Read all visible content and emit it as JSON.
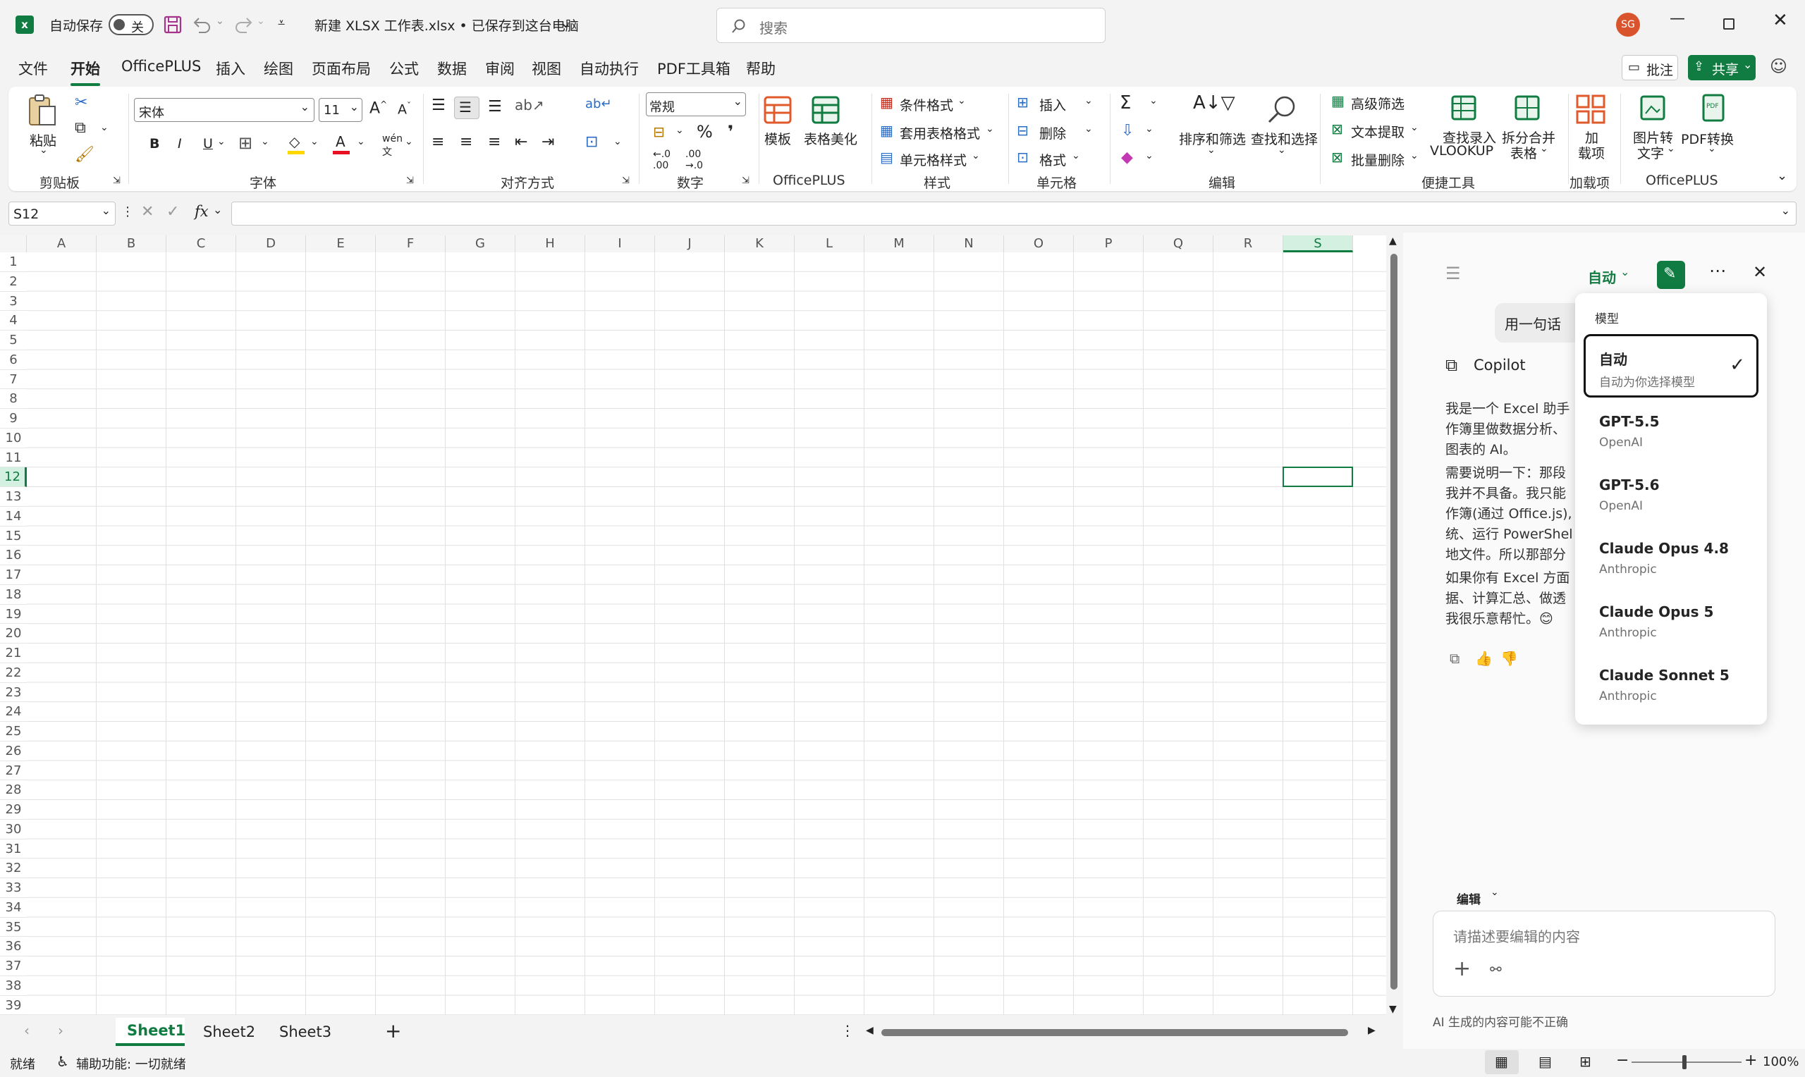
{
  "titlebar": {
    "autosave_label": "自动保存",
    "autosave_state": "关",
    "file_title": "新建 XLSX 工作表.xlsx • 已保存到这台电脑",
    "search_placeholder": "搜索",
    "avatar_initials": "SG"
  },
  "menu": {
    "items": [
      "文件",
      "开始",
      "OfficePLUS",
      "插入",
      "绘图",
      "页面布局",
      "公式",
      "数据",
      "审阅",
      "视图",
      "自动执行",
      "PDF工具箱",
      "帮助"
    ],
    "active": "开始",
    "comment_label": "批注",
    "share_label": "共享"
  },
  "ribbon": {
    "clipboard": {
      "paste": "粘贴",
      "group": "剪贴板"
    },
    "font": {
      "name": "宋体",
      "size": "11",
      "group": "字体",
      "bold": "B",
      "italic": "I",
      "underline": "U"
    },
    "align": {
      "group": "对齐方式"
    },
    "number": {
      "format": "常规",
      "group": "数字"
    },
    "officeplus": {
      "template": "模板",
      "beautify": "表格美化",
      "group": "OfficePLUS"
    },
    "styles": {
      "cond": "条件格式",
      "table": "套用表格格式",
      "cell": "单元格样式",
      "group": "样式"
    },
    "cells": {
      "insert": "插入",
      "delete": "删除",
      "format": "格式",
      "group": "单元格"
    },
    "editing": {
      "sort": "排序和筛选",
      "find": "查找和选择",
      "group": "编辑"
    },
    "tools": {
      "advfilter": "高级筛选",
      "textextract": "文本提取",
      "batchdelete": "批量删除",
      "vlookup1": "查找录入",
      "vlookup2": "VLOOKUP",
      "split1": "拆分合并",
      "split2": "表格",
      "group": "便捷工具"
    },
    "addins": {
      "label1": "加",
      "label2": "载项",
      "group": "加载项"
    },
    "officeplus2": {
      "img1": "图片转",
      "img2": "文字",
      "pdf": "PDF转换",
      "group": "OfficePLUS"
    }
  },
  "formula": {
    "namebox": "S12",
    "fx": "fx"
  },
  "grid": {
    "columns": [
      "A",
      "B",
      "C",
      "D",
      "E",
      "F",
      "G",
      "H",
      "I",
      "J",
      "K",
      "L",
      "M",
      "N",
      "O",
      "P",
      "Q",
      "R",
      "S"
    ],
    "selected_col": "S",
    "selected_row": 12,
    "rows": [
      "1",
      "2",
      "3",
      "4",
      "5",
      "6",
      "7",
      "8",
      "9",
      "10",
      "11",
      "12",
      "13",
      "14",
      "15",
      "16",
      "17",
      "18",
      "19",
      "20",
      "21",
      "22",
      "23",
      "24",
      "25",
      "26",
      "27",
      "28",
      "29",
      "30",
      "31",
      "32",
      "33",
      "34",
      "35",
      "36",
      "37",
      "38",
      "39"
    ]
  },
  "sheets": {
    "tabs": [
      "Sheet1",
      "Sheet2",
      "Sheet3"
    ],
    "active": "Sheet1"
  },
  "status": {
    "ready": "就绪",
    "accessibility": "辅助功能: 一切就绪",
    "zoom": "100%"
  },
  "copilot": {
    "mode_label": "自动",
    "user_msg": "用一句话",
    "assistant_name": "Copilot",
    "para1_l1": "我是一个 Excel 助手",
    "para1_l2": "作簿里做数据分析、",
    "para1_l3": "图表的 AI。",
    "para2_l1": "需要说明一下：那段",
    "para2_l2": "我并不具备。我只能",
    "para2_l3": "作簿(通过 Office.js),",
    "para2_l4": "统、运行 PowerShel",
    "para2_l5": "地文件。所以那部分",
    "para3_l1": "如果你有 Excel 方面",
    "para3_l2": "据、计算汇总、做透",
    "para3_l3": "我很乐意帮忙。😊",
    "edit_mode": "编辑",
    "input_placeholder": "请描述要编辑的内容",
    "disclaimer": "AI 生成的内容可能不正确"
  },
  "model_menu": {
    "header": "模型",
    "options": [
      {
        "name": "自动",
        "sub": "自动为你选择模型",
        "selected": true
      },
      {
        "name": "GPT-5.5",
        "sub": "OpenAI"
      },
      {
        "name": "GPT-5.6",
        "sub": "OpenAI"
      },
      {
        "name": "Claude Opus 4.8",
        "sub": "Anthropic"
      },
      {
        "name": "Claude Opus 5",
        "sub": "Anthropic"
      },
      {
        "name": "Claude Sonnet 5",
        "sub": "Anthropic"
      }
    ]
  },
  "colors": {
    "accent": "#107c41",
    "save_icon": "#a4338b",
    "avatar": "#d9542c",
    "font_red": "#e81123",
    "fill_yellow": "#ffd800"
  }
}
